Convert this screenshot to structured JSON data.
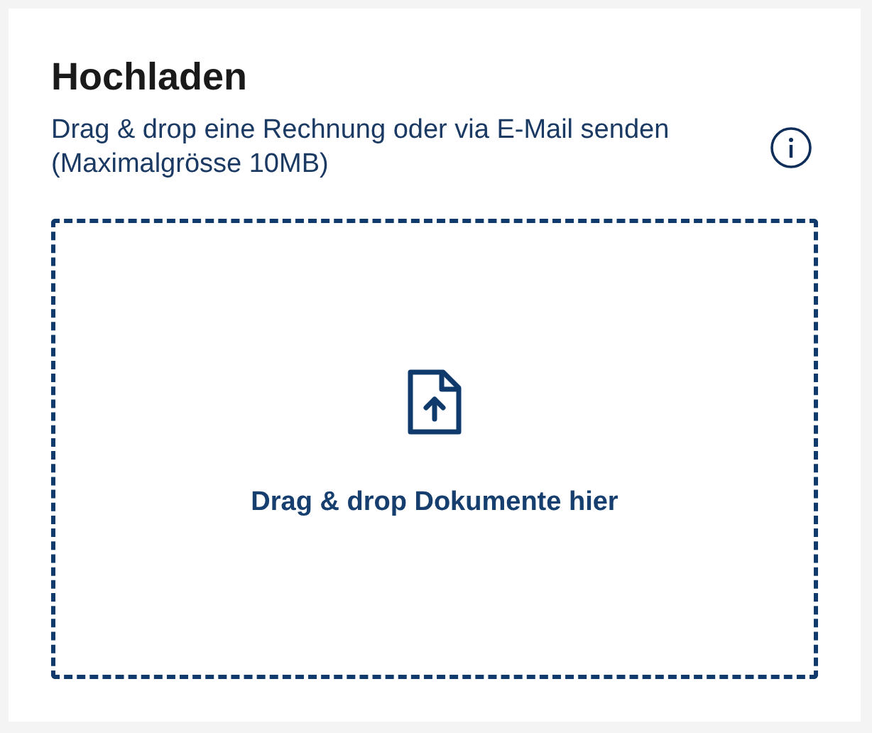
{
  "card": {
    "title": "Hochladen",
    "subtitle": "Drag & drop eine Rechnung oder via E-Mail senden (Maximalgrösse 10MB)"
  },
  "dropzone": {
    "label": "Drag & drop Dokumente hier"
  }
}
